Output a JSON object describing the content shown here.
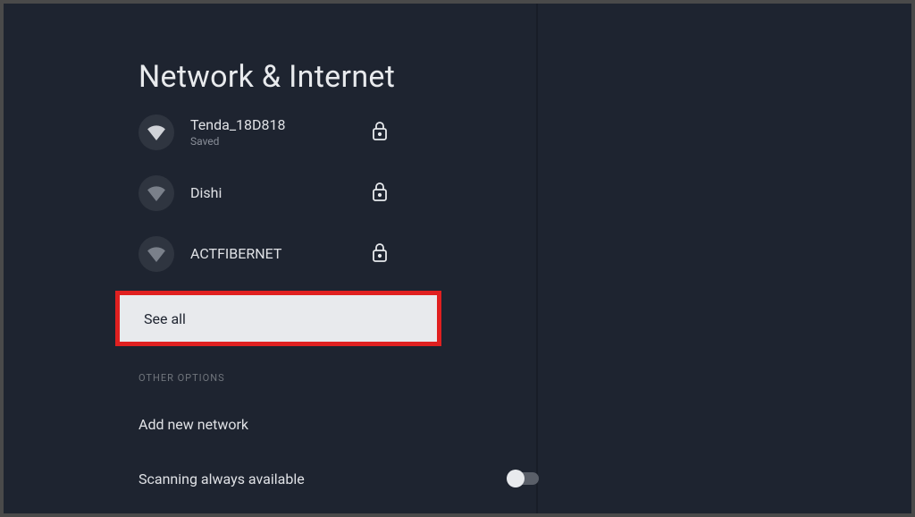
{
  "title": "Network & Internet",
  "networks": [
    {
      "name": "Tenda_18D818",
      "sub": "Saved",
      "signal": "bright",
      "locked": true
    },
    {
      "name": "Dishi",
      "sub": "",
      "signal": "dim",
      "locked": true
    },
    {
      "name": "ACTFIBERNET",
      "sub": "",
      "signal": "dim",
      "locked": true
    }
  ],
  "see_all_label": "See all",
  "other_options_header": "OTHER OPTIONS",
  "add_network_label": "Add new network",
  "scanning_label": "Scanning always available",
  "scanning_on": false
}
